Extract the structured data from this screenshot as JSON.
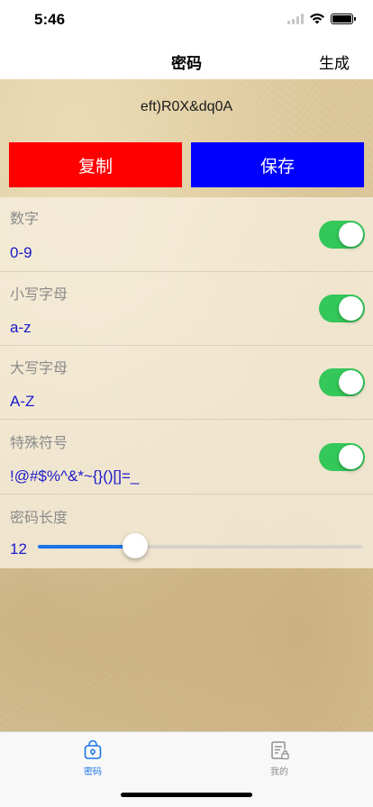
{
  "status_bar": {
    "time": "5:46"
  },
  "nav": {
    "title": "密码",
    "action": "生成"
  },
  "password": "eft)R0X&dq0A",
  "buttons": {
    "copy": "复制",
    "save": "保存"
  },
  "options": [
    {
      "label": "数字",
      "value": "0-9",
      "enabled": true
    },
    {
      "label": "小写字母",
      "value": "a-z",
      "enabled": true
    },
    {
      "label": "大写字母",
      "value": "A-Z",
      "enabled": true
    },
    {
      "label": "特殊符号",
      "value": "!@#$%^&*~{}()[]=_",
      "enabled": true
    }
  ],
  "length": {
    "label": "密码长度",
    "value": "12",
    "slider_fraction": 0.3
  },
  "tabs": [
    {
      "label": "密码",
      "icon": "lock-bag-icon",
      "active": true
    },
    {
      "label": "我的",
      "icon": "document-lock-icon",
      "active": false
    }
  ],
  "colors": {
    "copy_button": "#ff0000",
    "save_button": "#0000ff",
    "toggle_on": "#34c759",
    "accent": "#1a73e8",
    "value_text": "#1a1acb"
  }
}
